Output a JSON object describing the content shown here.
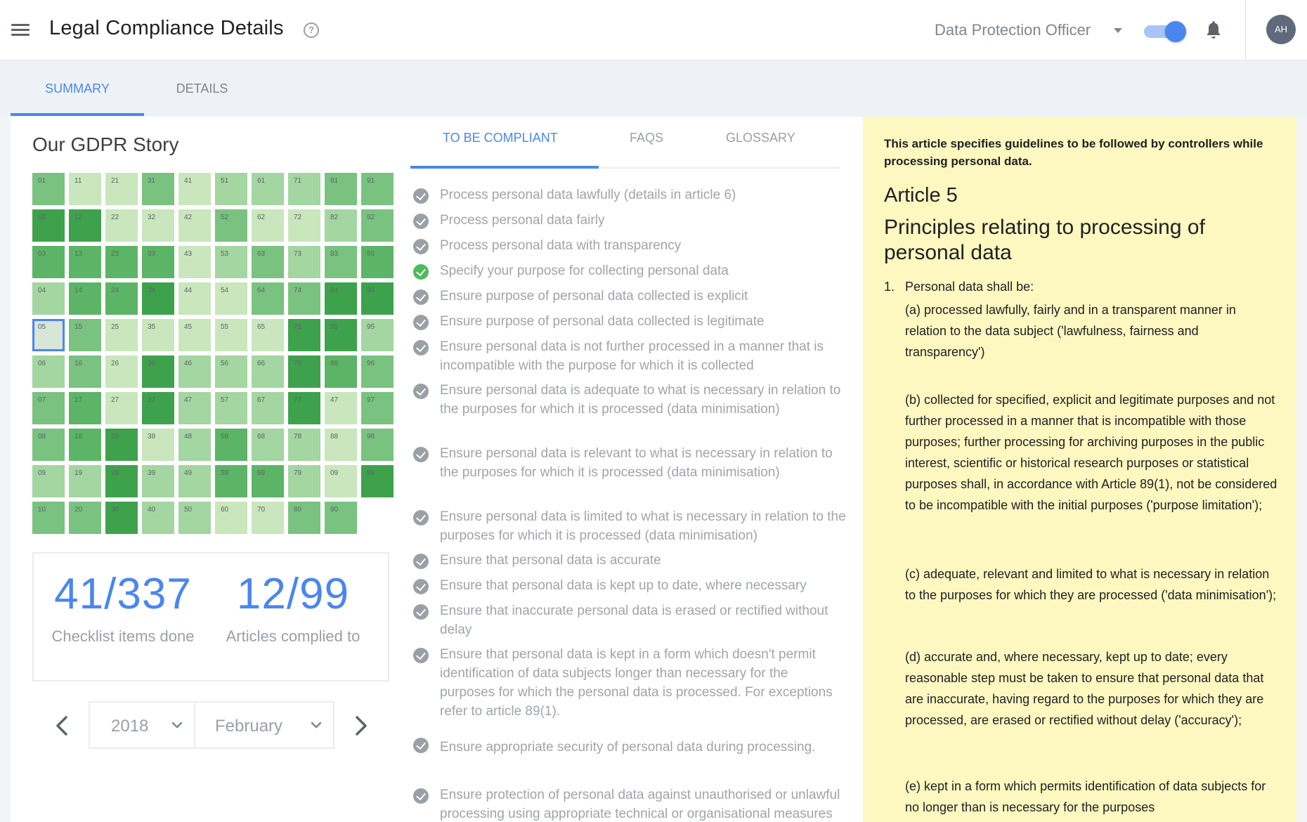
{
  "header": {
    "title": "Legal Compliance Details",
    "role": "Data Protection Officer",
    "avatar_initials": "AH",
    "accent_color": "#4a86f0"
  },
  "main_tabs": [
    {
      "label": "SUMMARY",
      "active": true
    },
    {
      "label": "DETAILS",
      "active": false
    }
  ],
  "story": {
    "title": "Our GDPR Story",
    "grid": [
      [
        {
          "l": "01",
          "s": 3
        },
        {
          "l": "11",
          "s": 1
        },
        {
          "l": "21",
          "s": 1
        },
        {
          "l": "31",
          "s": 3
        },
        {
          "l": "41",
          "s": 1
        },
        {
          "l": "51",
          "s": 2
        },
        {
          "l": "61",
          "s": 2
        },
        {
          "l": "71",
          "s": 2
        },
        {
          "l": "81",
          "s": 3
        },
        {
          "l": "91",
          "s": 3
        }
      ],
      [
        {
          "l": "02",
          "s": 5
        },
        {
          "l": "12",
          "s": 5
        },
        {
          "l": "22",
          "s": 1
        },
        {
          "l": "32",
          "s": 1
        },
        {
          "l": "42",
          "s": 1
        },
        {
          "l": "52",
          "s": 3
        },
        {
          "l": "62",
          "s": 1
        },
        {
          "l": "72",
          "s": 1
        },
        {
          "l": "82",
          "s": 2
        },
        {
          "l": "92",
          "s": 3
        }
      ],
      [
        {
          "l": "03",
          "s": 4
        },
        {
          "l": "13",
          "s": 4
        },
        {
          "l": "23",
          "s": 4
        },
        {
          "l": "33",
          "s": 4
        },
        {
          "l": "43",
          "s": 1
        },
        {
          "l": "53",
          "s": 2
        },
        {
          "l": "63",
          "s": 3
        },
        {
          "l": "73",
          "s": 2
        },
        {
          "l": "83",
          "s": 3
        },
        {
          "l": "93",
          "s": 4
        }
      ],
      [
        {
          "l": "04",
          "s": 2
        },
        {
          "l": "14",
          "s": 4
        },
        {
          "l": "24",
          "s": 4
        },
        {
          "l": "34",
          "s": 5
        },
        {
          "l": "44",
          "s": 1
        },
        {
          "l": "54",
          "s": 1
        },
        {
          "l": "64",
          "s": 3
        },
        {
          "l": "74",
          "s": 3
        },
        {
          "l": "84",
          "s": 5
        },
        {
          "l": "94",
          "s": 5
        }
      ],
      [
        {
          "l": "05",
          "s": 0
        },
        {
          "l": "15",
          "s": 3
        },
        {
          "l": "25",
          "s": 1
        },
        {
          "l": "35",
          "s": 1
        },
        {
          "l": "45",
          "s": 1
        },
        {
          "l": "55",
          "s": 1
        },
        {
          "l": "65",
          "s": 1
        },
        {
          "l": "75",
          "s": 5
        },
        {
          "l": "85",
          "s": 5
        },
        {
          "l": "95",
          "s": 2
        }
      ],
      [
        {
          "l": "06",
          "s": 2
        },
        {
          "l": "16",
          "s": 3
        },
        {
          "l": "26",
          "s": 1
        },
        {
          "l": "36",
          "s": 5
        },
        {
          "l": "46",
          "s": 2
        },
        {
          "l": "56",
          "s": 2
        },
        {
          "l": "66",
          "s": 2
        },
        {
          "l": "76",
          "s": 5
        },
        {
          "l": "86",
          "s": 4
        },
        {
          "l": "96",
          "s": 3
        }
      ],
      [
        {
          "l": "07",
          "s": 3
        },
        {
          "l": "17",
          "s": 4
        },
        {
          "l": "27",
          "s": 1
        },
        {
          "l": "37",
          "s": 5
        },
        {
          "l": "47",
          "s": 2
        },
        {
          "l": "57",
          "s": 2
        },
        {
          "l": "67",
          "s": 2
        },
        {
          "l": "77",
          "s": 5
        },
        {
          "l": "47",
          "s": 1
        },
        {
          "l": "97",
          "s": 3
        }
      ],
      [
        {
          "l": "08",
          "s": 3
        },
        {
          "l": "18",
          "s": 4
        },
        {
          "l": "28",
          "s": 5
        },
        {
          "l": "38",
          "s": 1
        },
        {
          "l": "48",
          "s": 2
        },
        {
          "l": "58",
          "s": 4
        },
        {
          "l": "68",
          "s": 2
        },
        {
          "l": "78",
          "s": 2
        },
        {
          "l": "88",
          "s": 1
        },
        {
          "l": "98",
          "s": 3
        }
      ],
      [
        {
          "l": "09",
          "s": 2
        },
        {
          "l": "19",
          "s": 2
        },
        {
          "l": "29",
          "s": 5
        },
        {
          "l": "39",
          "s": 2
        },
        {
          "l": "49",
          "s": 2
        },
        {
          "l": "59",
          "s": 4
        },
        {
          "l": "69",
          "s": 4
        },
        {
          "l": "79",
          "s": 2
        },
        {
          "l": "09",
          "s": 1
        },
        {
          "l": "99",
          "s": 5
        }
      ],
      [
        {
          "l": "10",
          "s": 3
        },
        {
          "l": "20",
          "s": 3
        },
        {
          "l": "30",
          "s": 5
        },
        {
          "l": "40",
          "s": 2
        },
        {
          "l": "50",
          "s": 2
        },
        {
          "l": "60",
          "s": 1
        },
        {
          "l": "70",
          "s": 1
        },
        {
          "l": "80",
          "s": 3
        },
        {
          "l": "90",
          "s": 3
        }
      ]
    ],
    "shade_colors": [
      "#dfe9df",
      "#c9e6bd",
      "#a3d6a0",
      "#79c280",
      "#5cb466",
      "#3ea24c"
    ],
    "stats": [
      {
        "value": "41/337",
        "label": "Checklist items done"
      },
      {
        "value": "12/99",
        "label": "Articles complied to"
      }
    ],
    "year": "2018",
    "month": "February"
  },
  "sub_tabs": [
    {
      "label": "TO BE COMPLIANT",
      "active": true
    },
    {
      "label": "FAQS",
      "active": false
    },
    {
      "label": "GLOSSARY",
      "active": false
    }
  ],
  "checklist": [
    {
      "text": "Process personal data lawfully (details in article 6)",
      "done": false
    },
    {
      "text": "Process personal data fairly",
      "done": false
    },
    {
      "text": "Process personal data with transparency",
      "done": false
    },
    {
      "text": "Specify your purpose for collecting personal data",
      "done": true
    },
    {
      "text": "Ensure purpose of personal data collected is explicit",
      "done": false
    },
    {
      "text": "Ensure purpose of personal data collected is legitimate",
      "done": false
    },
    {
      "text": "Ensure personal data is not further processed in a manner that is incompatible with the purpose for which it is collected",
      "done": false
    },
    {
      "text": "Ensure personal data is adequate to what is necessary in relation to the purposes for which it is processed (data minimisation)",
      "done": false
    },
    {
      "text": "Ensure personal data is relevant to what is necessary in relation to the purposes for which it is processed (data minimisation)",
      "done": false
    },
    {
      "text": "Ensure personal data is limited to what is necessary in relation to the purposes for which it is processed (data minimisation)",
      "done": false
    },
    {
      "text": "Ensure that personal data is accurate",
      "done": false
    },
    {
      "text": "Ensure that personal data is kept up to date, where necessary",
      "done": false
    },
    {
      "text": "Ensure that inaccurate personal data is erased or rectified without delay",
      "done": false
    },
    {
      "text": "Ensure that personal data is kept in a form which doesn't permit identification of data subjects longer than necessary for the purposes for which the personal data is processed. For exceptions refer to article 89(1).",
      "done": false
    },
    {
      "text": "Ensure appropriate security of personal data during processing.",
      "done": false
    },
    {
      "text": "Ensure protection of personal data against unauthorised or unlawful processing using appropriate technical or organisational measures",
      "done": false
    }
  ],
  "article": {
    "intro": "This article specifies guidelines to be followed by controllers while processing personal data.",
    "number": "Article 5",
    "title": "Principles relating to processing of personal data",
    "lead_num": "1.",
    "lead": "Personal data shall be:",
    "clauses": [
      "(a)  processed lawfully, fairly and in a transparent manner in relation to the data subject ('lawfulness, fairness and transparency')",
      "(b)  collected for specified, explicit and legitimate purposes and not further processed in a manner that is incompatible with those purposes; further processing for archiving purposes in the public interest, scientific or historical research purposes or statistical purposes shall, in accordance with Article 89(1), not be considered to be incompatible with the initial purposes ('purpose limitation');",
      "(c)  adequate, relevant and limited to what is necessary in relation to the purposes for which they are processed ('data minimisation');",
      "(d)  accurate and, where necessary, kept up to date; every reasonable step must be taken to ensure that personal data that are inaccurate, having regard to the purposes for which they are processed, are erased or rectified without delay ('accuracy');",
      "(e)  kept in a form which permits identification of data subjects for no longer than is necessary for the purposes"
    ]
  }
}
